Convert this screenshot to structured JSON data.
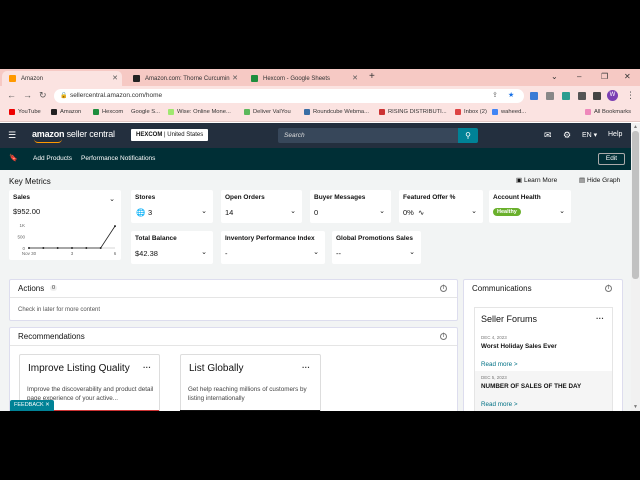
{
  "browser": {
    "tabs": [
      {
        "title": "Amazon",
        "active": true
      },
      {
        "title": "Amazon.com: Thorne Curcumin",
        "active": false
      },
      {
        "title": "Hexcom - Google Sheets",
        "active": false
      }
    ],
    "url": "sellercentral.amazon.com/home",
    "profile_initial": "W",
    "bookmarks": [
      "YouTube",
      "Amazon",
      "Hexcom",
      "Google S...",
      "Wise: Online Mone...",
      "Deliver VaIYou",
      "Roundcube Webma...",
      "RISING DISTRIBUTI...",
      "Inbox (2)",
      "waheed..."
    ],
    "all_bookmarks": "All Bookmarks"
  },
  "header": {
    "logo_bold": "amazon",
    "logo_light": " seller central",
    "store_name": "HEXCOM",
    "store_region": "| United States",
    "search_placeholder": "Search",
    "lang": "EN ▾",
    "help": "Help"
  },
  "subnav": {
    "links": [
      "Add Products",
      "Performance Notifications"
    ],
    "edit": "Edit"
  },
  "key_metrics": {
    "title": "Key Metrics",
    "learn_more": "Learn More",
    "hide_graph": "Hide Graph",
    "sales": {
      "label": "Sales",
      "value": "$952.00",
      "chart_y_labels": [
        "1K",
        "500",
        "0"
      ],
      "chart_x_labels": [
        "Nov 30",
        "3",
        "6"
      ]
    },
    "stores": {
      "label": "Stores",
      "value": "3"
    },
    "open_orders": {
      "label": "Open Orders",
      "value": "14"
    },
    "buyer_messages": {
      "label": "Buyer Messages",
      "value": "0"
    },
    "featured_offer": {
      "label": "Featured Offer %",
      "value": "0%"
    },
    "account_health": {
      "label": "Account Health",
      "value": "Healthy"
    },
    "total_balance": {
      "label": "Total Balance",
      "value": "$42.38"
    },
    "inventory_perf": {
      "label": "Inventory Performance Index",
      "value": "-"
    },
    "global_promotions": {
      "label": "Global Promotions Sales",
      "value": "--"
    }
  },
  "actions": {
    "title": "Actions",
    "count": "0",
    "note": "Check in later for more content"
  },
  "recommendations": {
    "title": "Recommendations",
    "cards": [
      {
        "title": "Improve Listing Quality",
        "body": "Improve the discoverability and product detail page experience of your active..."
      },
      {
        "title": "List Globally",
        "body": "Get help reaching millions of customers by listing internationally"
      }
    ]
  },
  "communications": {
    "title": "Communications",
    "forums_title": "Seller Forums",
    "posts": [
      {
        "date": "DEC 4, 2023",
        "title": "Worst Holiday Sales Ever",
        "link": "Read more >"
      },
      {
        "date": "DEC 5, 2023",
        "title": "NUMBER OF SALES OF THE DAY",
        "link": "Read more >"
      }
    ]
  },
  "feedback": "FEEDBACK ✕",
  "colors": {
    "header_bg": "#232f3e",
    "subnav_bg": "#002f36",
    "accent": "#008296",
    "healthy": "#6ab02c"
  },
  "chart_data": {
    "type": "line",
    "x": [
      "Nov 30",
      "",
      "",
      "3",
      "",
      "",
      "6"
    ],
    "values": [
      0,
      0,
      0,
      0,
      0,
      0,
      952
    ],
    "ylim": [
      0,
      1000
    ]
  }
}
